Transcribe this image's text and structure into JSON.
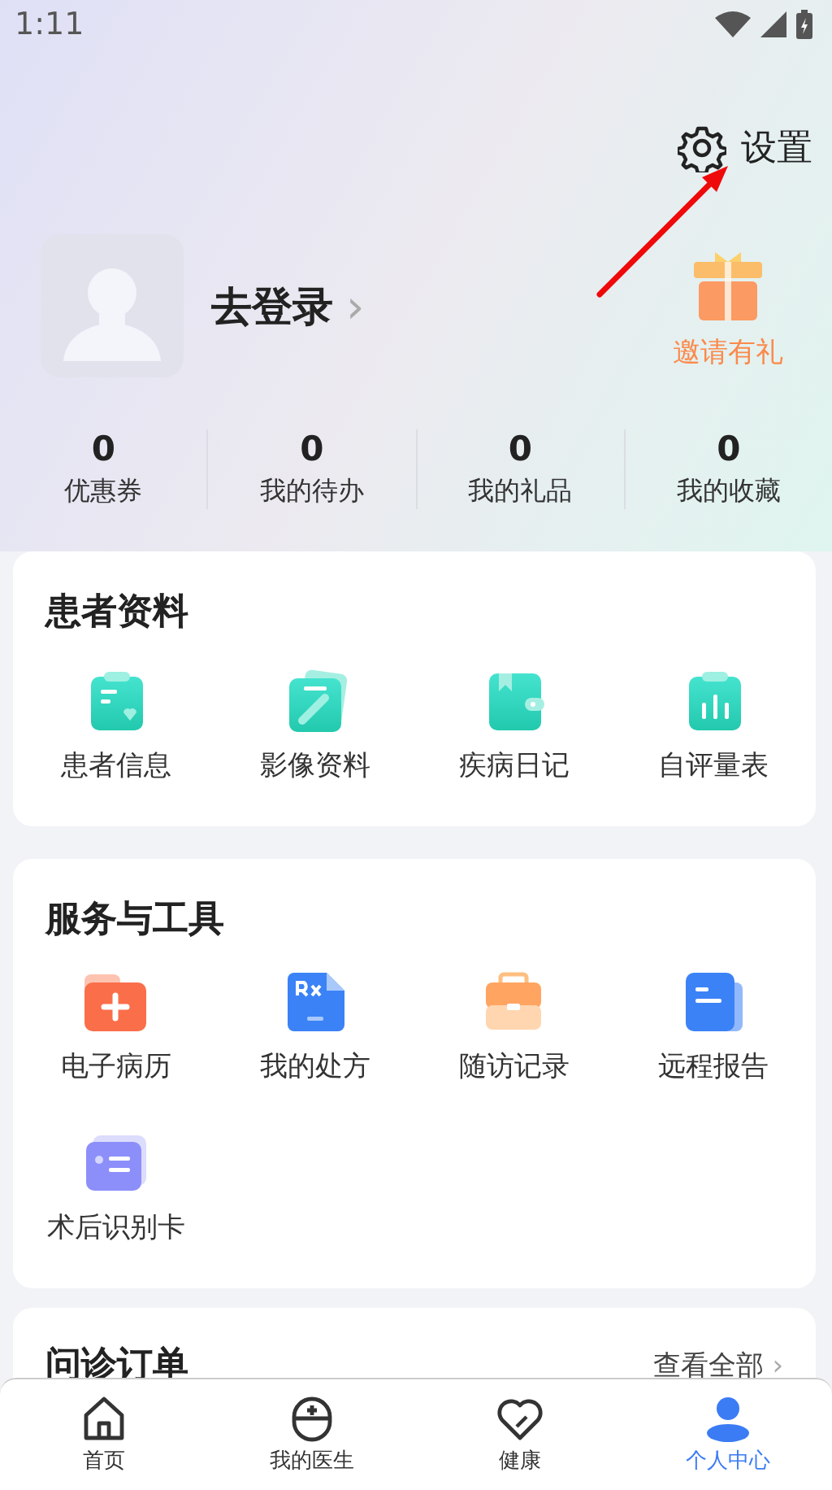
{
  "status_bar": {
    "time": "1:11"
  },
  "settings": {
    "label": "设置"
  },
  "profile": {
    "login": "去登录",
    "chevron": "›"
  },
  "invite": {
    "label": "邀请有礼"
  },
  "stats": [
    {
      "value": "0",
      "label": "优惠券"
    },
    {
      "value": "0",
      "label": "我的待办"
    },
    {
      "value": "0",
      "label": "我的礼品"
    },
    {
      "value": "0",
      "label": "我的收藏"
    }
  ],
  "patient_card": {
    "title": "患者资料",
    "items": [
      "患者信息",
      "影像资料",
      "疾病日记",
      "自评量表"
    ]
  },
  "tools_card": {
    "title": "服务与工具",
    "items": [
      "电子病历",
      "我的处方",
      "随访记录",
      "远程报告",
      "术后识别卡"
    ]
  },
  "orders_card": {
    "title": "问诊订单",
    "link": "查看全部",
    "chevron": "›"
  },
  "tabs": [
    {
      "label": "首页",
      "selected": false
    },
    {
      "label": "我的医生",
      "selected": false
    },
    {
      "label": "健康",
      "selected": false
    },
    {
      "label": "个人中心",
      "selected": true
    }
  ]
}
